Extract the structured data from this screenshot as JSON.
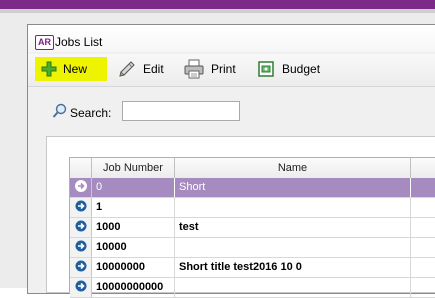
{
  "window": {
    "icon_text": "AR",
    "title": "Jobs List"
  },
  "toolbar": {
    "new_label": "New",
    "edit_label": "Edit",
    "print_label": "Print",
    "budget_label": "Budget",
    "highlight_color": "#eef300"
  },
  "search": {
    "label": "Search:",
    "value": "",
    "placeholder": ""
  },
  "table": {
    "columns": [
      "Job Number",
      "Name"
    ],
    "rows": [
      {
        "job_number": "0",
        "name": "Short",
        "selected": true
      },
      {
        "job_number": "1",
        "name": ""
      },
      {
        "job_number": "1000",
        "name": "test"
      },
      {
        "job_number": "10000",
        "name": ""
      },
      {
        "job_number": "10000000",
        "name": "Short title test2016 10 0"
      },
      {
        "job_number": "10000000000",
        "name": ""
      }
    ]
  },
  "colors": {
    "accent": "#7b2a8a",
    "selection": "#a58bbf",
    "row_arrow": "#1f5f9e"
  }
}
